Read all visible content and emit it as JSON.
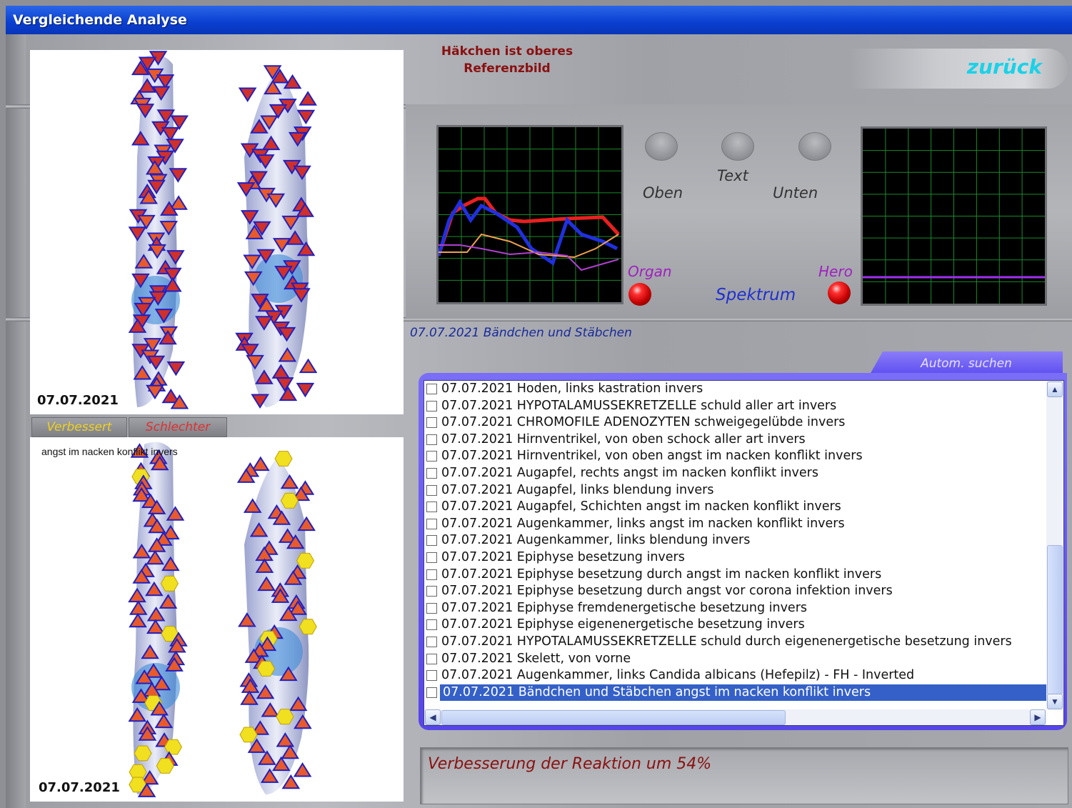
{
  "window": {
    "title": "Vergleichende Analyse"
  },
  "top_panel": {
    "date": "07.07.2021"
  },
  "tabs": {
    "better": "Verbessert",
    "worse": "Schlechter"
  },
  "bottom_panel": {
    "caption": "angst im nacken konflikt invers",
    "date": "07.07.2021"
  },
  "hint": {
    "line1": "Häkchen ist oberes",
    "line2": "Referenzbild"
  },
  "back_button": {
    "label": "zurück"
  },
  "controls": {
    "knob_top": "Oben",
    "knob_text": "Text",
    "knob_bottom": "Unten",
    "organ": "Organ",
    "hero": "Hero",
    "spektrum": "Spektrum"
  },
  "selected_info": "07.07.2021 Bändchen und Stäbchen",
  "auto_search": "Autom. suchen",
  "list": {
    "items": [
      {
        "text": "07.07.2021  Hoden, links  kastration invers",
        "selected": false
      },
      {
        "text": "07.07.2021  HYPOTALAMUSSEKRETZELLE  schuld aller art invers",
        "selected": false
      },
      {
        "text": "07.07.2021  CHROMOFILE ADENOZYTEN  schweigegelübde invers",
        "selected": false
      },
      {
        "text": "07.07.2021  Hirnventrikel, von oben  schock aller art invers",
        "selected": false
      },
      {
        "text": "07.07.2021  Hirnventrikel, von oben  angst im nacken konflikt invers",
        "selected": false
      },
      {
        "text": "07.07.2021  Augapfel, rechts  angst im nacken konflikt invers",
        "selected": false
      },
      {
        "text": "07.07.2021  Augapfel, links  blendung invers",
        "selected": false
      },
      {
        "text": "07.07.2021  Augapfel, Schichten  angst im nacken konflikt invers",
        "selected": false
      },
      {
        "text": "07.07.2021  Augenkammer, links  angst im nacken konflikt invers",
        "selected": false
      },
      {
        "text": "07.07.2021  Augenkammer, links  blendung invers",
        "selected": false
      },
      {
        "text": "07.07.2021  Epiphyse  besetzung invers",
        "selected": false
      },
      {
        "text": "07.07.2021  Epiphyse  besetzung durch angst im nacken konflikt invers",
        "selected": false
      },
      {
        "text": "07.07.2021  Epiphyse  besetzung durch angst vor corona infektion invers",
        "selected": false
      },
      {
        "text": "07.07.2021  Epiphyse  fremdenergetische besetzung invers",
        "selected": false
      },
      {
        "text": "07.07.2021  Epiphyse  eigenenergetische besetzung invers",
        "selected": false
      },
      {
        "text": "07.07.2021  HYPOTALAMUSSEKRETZELLE  schuld durch eigenenergetische besetzung invers",
        "selected": false
      },
      {
        "text": "07.07.2021  Skelett, von vorne",
        "selected": false
      },
      {
        "text": "07.07.2021  Augenkammer, links  Candida albicans (Hefepilz) - FH - Inverted",
        "selected": false
      },
      {
        "text": "07.07.2021  Bändchen und Stäbchen  angst im nacken konflikt invers",
        "selected": true
      }
    ]
  },
  "status": "Verbesserung der Reaktion um 54%",
  "colors": {
    "title_bar": "#0a3ed0",
    "accent_cyan": "#19d2e8",
    "hint_red": "#8a1010",
    "list_selection": "#3460c8",
    "marker_down": "#d0302a",
    "marker_up": "#e85a2a",
    "marker_hex": "#f0e020",
    "scope_grid": "#1a8a2a"
  }
}
